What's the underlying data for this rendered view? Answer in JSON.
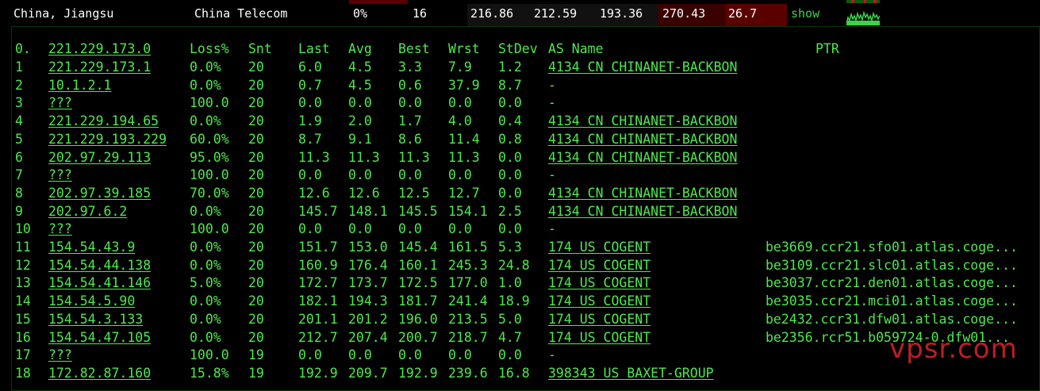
{
  "top": {
    "location": "China, Jiangsu",
    "isp": "China Telecom",
    "loss": "0%",
    "sent": "16",
    "last": "216.86",
    "avg": "212.59",
    "best": "193.36",
    "worst": "270.43",
    "stdev": "26.7",
    "show_label": "show"
  },
  "header": {
    "idx": "0.",
    "host": "221.229.173.0",
    "loss": "Loss%",
    "snt": "Snt",
    "last": "Last",
    "avg": "Avg",
    "best": "Best",
    "wrst": "Wrst",
    "stdev": "StDev",
    "asn": "AS Name",
    "ptr": "PTR"
  },
  "hops": [
    {
      "idx": "1",
      "host": "221.229.173.1",
      "loss": "0.0%",
      "snt": "20",
      "last": "6.0",
      "avg": "4.5",
      "best": "3.3",
      "wrst": "7.9",
      "stdev": "1.2",
      "as": "4134  CN CHINANET-BACKBON",
      "ptr": ""
    },
    {
      "idx": "2",
      "host": "10.1.2.1",
      "loss": "0.0%",
      "snt": "20",
      "last": "0.7",
      "avg": "4.5",
      "best": "0.6",
      "wrst": "37.9",
      "stdev": "8.7",
      "as": "-",
      "ptr": ""
    },
    {
      "idx": "3",
      "host": "???",
      "loss": "100.0",
      "snt": "20",
      "last": "0.0",
      "avg": "0.0",
      "best": "0.0",
      "wrst": "0.0",
      "stdev": "0.0",
      "as": "-",
      "ptr": ""
    },
    {
      "idx": "4",
      "host": "221.229.194.65",
      "loss": "0.0%",
      "snt": "20",
      "last": "1.9",
      "avg": "2.0",
      "best": "1.7",
      "wrst": "4.0",
      "stdev": "0.4",
      "as": "4134  CN CHINANET-BACKBON",
      "ptr": ""
    },
    {
      "idx": "5",
      "host": "221.229.193.229",
      "loss": "60.0%",
      "snt": "20",
      "last": "8.7",
      "avg": "9.1",
      "best": "8.6",
      "wrst": "11.4",
      "stdev": "0.8",
      "as": "4134  CN CHINANET-BACKBON",
      "ptr": ""
    },
    {
      "idx": "6",
      "host": "202.97.29.113",
      "loss": "95.0%",
      "snt": "20",
      "last": "11.3",
      "avg": "11.3",
      "best": "11.3",
      "wrst": "11.3",
      "stdev": "0.0",
      "as": "4134  CN CHINANET-BACKBON",
      "ptr": ""
    },
    {
      "idx": "7",
      "host": "???",
      "loss": "100.0",
      "snt": "20",
      "last": "0.0",
      "avg": "0.0",
      "best": "0.0",
      "wrst": "0.0",
      "stdev": "0.0",
      "as": "-",
      "ptr": ""
    },
    {
      "idx": "8",
      "host": "202.97.39.185",
      "loss": "70.0%",
      "snt": "20",
      "last": "12.6",
      "avg": "12.6",
      "best": "12.5",
      "wrst": "12.7",
      "stdev": "0.0",
      "as": "4134  CN CHINANET-BACKBON",
      "ptr": ""
    },
    {
      "idx": "9",
      "host": "202.97.6.2",
      "loss": "0.0%",
      "snt": "20",
      "last": "145.7",
      "avg": "148.1",
      "best": "145.5",
      "wrst": "154.1",
      "stdev": "2.5",
      "as": "4134  CN CHINANET-BACKBON",
      "ptr": ""
    },
    {
      "idx": "10",
      "host": "???",
      "loss": "100.0",
      "snt": "20",
      "last": "0.0",
      "avg": "0.0",
      "best": "0.0",
      "wrst": "0.0",
      "stdev": "0.0",
      "as": "-",
      "ptr": ""
    },
    {
      "idx": "11",
      "host": "154.54.43.9",
      "loss": "0.0%",
      "snt": "20",
      "last": "151.7",
      "avg": "153.0",
      "best": "145.4",
      "wrst": "161.5",
      "stdev": "5.3",
      "as": "174   US COGENT",
      "ptr": "be3669.ccr21.sfo01.atlas.coge..."
    },
    {
      "idx": "12",
      "host": "154.54.44.138",
      "loss": "0.0%",
      "snt": "20",
      "last": "160.9",
      "avg": "176.4",
      "best": "160.1",
      "wrst": "245.3",
      "stdev": "24.8",
      "as": "174   US COGENT",
      "ptr": "be3109.ccr21.slc01.atlas.coge..."
    },
    {
      "idx": "13",
      "host": "154.54.41.146",
      "loss": "5.0%",
      "snt": "20",
      "last": "172.7",
      "avg": "173.7",
      "best": "172.5",
      "wrst": "177.0",
      "stdev": "1.0",
      "as": "174   US COGENT",
      "ptr": "be3037.ccr21.den01.atlas.coge..."
    },
    {
      "idx": "14",
      "host": "154.54.5.90",
      "loss": "0.0%",
      "snt": "20",
      "last": "182.1",
      "avg": "194.3",
      "best": "181.7",
      "wrst": "241.4",
      "stdev": "18.9",
      "as": "174   US COGENT",
      "ptr": "be3035.ccr21.mci01.atlas.coge..."
    },
    {
      "idx": "15",
      "host": "154.54.3.133",
      "loss": "0.0%",
      "snt": "20",
      "last": "201.1",
      "avg": "201.2",
      "best": "196.0",
      "wrst": "213.5",
      "stdev": "5.0",
      "as": "174   US COGENT",
      "ptr": "be2432.ccr31.dfw01.atlas.coge..."
    },
    {
      "idx": "16",
      "host": "154.54.47.105",
      "loss": "0.0%",
      "snt": "20",
      "last": "212.7",
      "avg": "207.4",
      "best": "200.7",
      "wrst": "218.7",
      "stdev": "4.7",
      "as": "174   US COGENT",
      "ptr": "be2356.rcr51.b059724-0.dfw01..."
    },
    {
      "idx": "17",
      "host": "???",
      "loss": "100.0",
      "snt": "19",
      "last": "0.0",
      "avg": "0.0",
      "best": "0.0",
      "wrst": "0.0",
      "stdev": "0.0",
      "as": "-",
      "ptr": ""
    },
    {
      "idx": "18",
      "host": "172.82.87.160",
      "loss": "15.8%",
      "snt": "19",
      "last": "192.9",
      "avg": "209.7",
      "best": "192.9",
      "wrst": "239.6",
      "stdev": "16.8",
      "as": "398343 US BAXET-GROUP",
      "ptr": ""
    }
  ],
  "watermark": "vpsr.com",
  "colors": {
    "text": "#4ee84e",
    "watermark": "#e0242b",
    "cell_red": "#5a0000"
  }
}
